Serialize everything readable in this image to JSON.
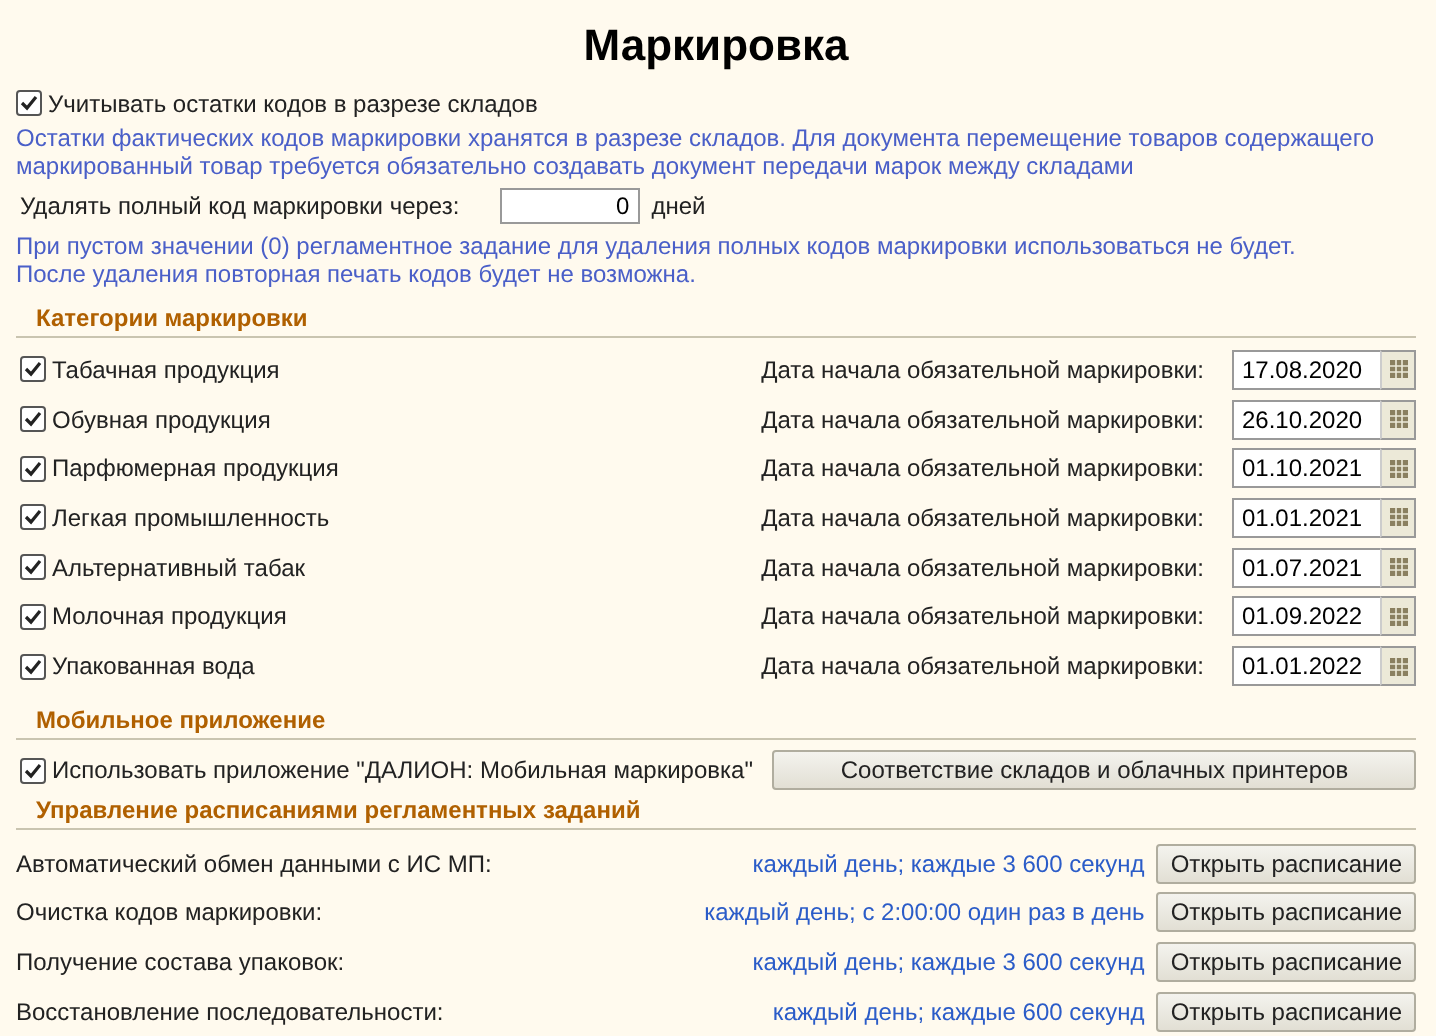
{
  "title": "Маркировка",
  "track_by_warehouse": {
    "label": "Учитывать остатки кодов в разрезе складов",
    "checked": true
  },
  "track_note": "Остатки фактических кодов маркировки хранятся в разрезе складов. Для документа перемещение товаров содержащего маркированный товар требуется обязательно создавать документ передачи марок между складами",
  "delete_codes": {
    "label": "Удалять полный код маркировки через:",
    "value": "0",
    "unit": "дней"
  },
  "delete_note": [
    "При пустом значении (0) регламентное задание для удаления полных кодов маркировки использоваться не будет.",
    "После удаления повторная печать кодов будет не возможна."
  ],
  "categories": {
    "heading": "Категории маркировки",
    "items": [
      {
        "label": "Табачная продукция",
        "checked": true,
        "date_label": "Дата начала обязательной маркировки:",
        "date": "17.08.2020"
      },
      {
        "label": "Обувная продукция",
        "checked": true,
        "date_label": "Дата начала обязательной маркировки:",
        "date": "26.10.2020"
      },
      {
        "label": "Парфюмерная продукция",
        "checked": true,
        "date_label": "Дата начала обязательной маркировки:",
        "date": "01.10.2021"
      },
      {
        "label": "Легкая промышленность",
        "checked": true,
        "date_label": "Дата начала обязательной маркировки:",
        "date": "01.01.2021"
      },
      {
        "label": "Альтернативный табак",
        "checked": true,
        "date_label": "Дата начала обязательной маркировки:",
        "date": "01.07.2021"
      },
      {
        "label": "Молочная продукция",
        "checked": true,
        "date_label": "Дата начала обязательной маркировки:",
        "date": "01.09.2022"
      },
      {
        "label": "Упакованная вода",
        "checked": true,
        "date_label": "Дата начала обязательной маркировки:",
        "date": "01.01.2022"
      }
    ]
  },
  "mobile": {
    "heading": "Мобильное приложение",
    "use_app": {
      "label": "Использовать приложение \"ДАЛИОН: Мобильная маркировка\"",
      "checked": true
    },
    "button": "Соответствие складов и облачных принтеров"
  },
  "schedules": {
    "heading": "Управление расписаниями регламентных заданий",
    "items": [
      {
        "label": "Автоматический обмен данными с ИС МП:",
        "schedule": "каждый день; каждые 3 600 секунд",
        "button": "Открыть расписание"
      },
      {
        "label": "Очистка кодов маркировки:",
        "schedule": "каждый день; с 2:00:00 один раз в день",
        "button": "Открыть расписание"
      },
      {
        "label": "Получение состава упаковок:",
        "schedule": "каждый день; каждые 3 600 секунд",
        "button": "Открыть расписание"
      },
      {
        "label": "Восстановление последовательности:",
        "schedule": "каждый день; каждые 600 секунд",
        "button": "Открыть расписание"
      }
    ]
  }
}
